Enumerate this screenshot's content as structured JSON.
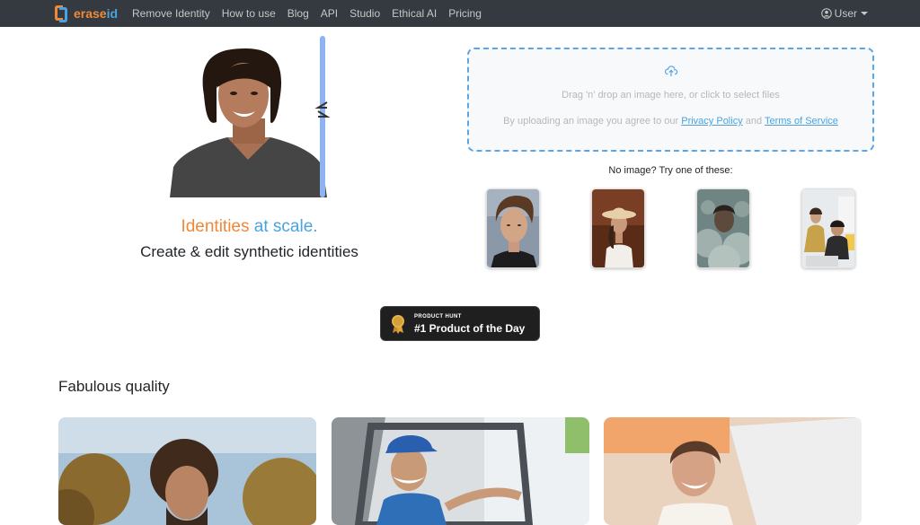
{
  "navbar": {
    "brand_part1": "erase",
    "brand_part2": "id",
    "links": [
      "Remove Identity",
      "How to use",
      "Blog",
      "API",
      "Studio",
      "Ethical AI",
      "Pricing"
    ],
    "user_label": "User"
  },
  "hero": {
    "tagline_part1": "Identities ",
    "tagline_part2": "at scale.",
    "subtitle": "Create & edit synthetic identities"
  },
  "dropzone": {
    "prompt": "Drag 'n' drop an image here, or click to select files",
    "terms_prefix": "By uploading an image you agree to our ",
    "privacy_link": "Privacy Policy",
    "terms_and": " and ",
    "terms_link": "Terms of Service"
  },
  "samples": {
    "heading": "No image? Try one of these:"
  },
  "product_hunt": {
    "label_small": "PRODUCT HUNT",
    "label_big": "#1 Product of the Day",
    "medal_number": "1"
  },
  "quality": {
    "heading": "Fabulous quality"
  },
  "icons": {
    "user": "user-circle-icon",
    "upload": "cloud-upload-icon",
    "slider": "compare-arrows-icon",
    "medal": "medal-icon"
  },
  "colors": {
    "navbar_bg": "#343a40",
    "brand_orange": "#f0883a",
    "brand_blue": "#4aa3df",
    "dropzone_border": "#5aa6e6"
  }
}
